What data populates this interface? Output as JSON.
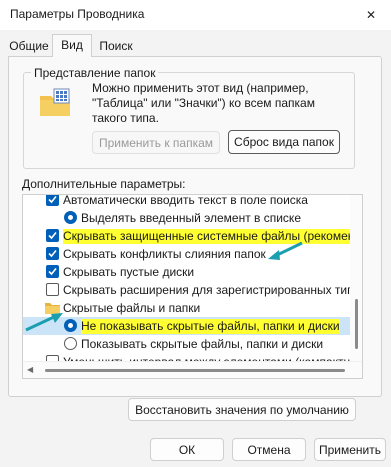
{
  "window": {
    "title": "Параметры Проводника",
    "close_glyph": "✕"
  },
  "tabs": [
    {
      "label": "Общие",
      "active": false
    },
    {
      "label": "Вид",
      "active": true
    },
    {
      "label": "Поиск",
      "active": false
    }
  ],
  "folder_views": {
    "group_label": "Представление папок",
    "description": "Можно применить этот вид (например, \"Таблица\" или \"Значки\") ко всем папкам такого типа.",
    "apply_button": "Применить к папкам",
    "reset_button": "Сброс вида папок"
  },
  "advanced": {
    "label": "Дополнительные параметры:",
    "items": [
      {
        "type": "checkbox",
        "checked": true,
        "text": "Автоматически вводить текст в поле поиска",
        "indent": 1,
        "partial": true
      },
      {
        "type": "radio",
        "checked": true,
        "text": "Выделять введенный элемент в списке",
        "indent": 2
      },
      {
        "type": "checkbox",
        "checked": true,
        "text": "Скрывать защищенные системные файлы (рекомен",
        "indent": 1,
        "highlight": "yellow"
      },
      {
        "type": "checkbox",
        "checked": true,
        "text": "Скрывать конфликты слияния папок",
        "indent": 1
      },
      {
        "type": "checkbox",
        "checked": true,
        "text": "Скрывать пустые диски",
        "indent": 1
      },
      {
        "type": "checkbox",
        "checked": false,
        "text": "Скрывать расширения для зарегистрированных типо",
        "indent": 1
      },
      {
        "type": "folder",
        "text": "Скрытые файлы и папки",
        "indent": 1
      },
      {
        "type": "radio",
        "checked": true,
        "text": "Не показывать скрытые файлы, папки и диски",
        "indent": 2,
        "highlight": "yellow-on-blue"
      },
      {
        "type": "radio",
        "checked": false,
        "text": "Показывать скрытые файлы, папки и диски",
        "indent": 2
      },
      {
        "type": "checkbox",
        "checked": false,
        "text": "Уменьшить интервал между элементами (компактн",
        "indent": 1
      }
    ]
  },
  "restore_defaults_button": "Восстановить значения по умолчанию",
  "footer": {
    "ok": "ОК",
    "cancel": "Отмена",
    "apply": "Применить"
  },
  "colors": {
    "accent": "#005fb8",
    "highlight_yellow": "#ffff32",
    "annotation_arrow": "#1b9fb0"
  }
}
